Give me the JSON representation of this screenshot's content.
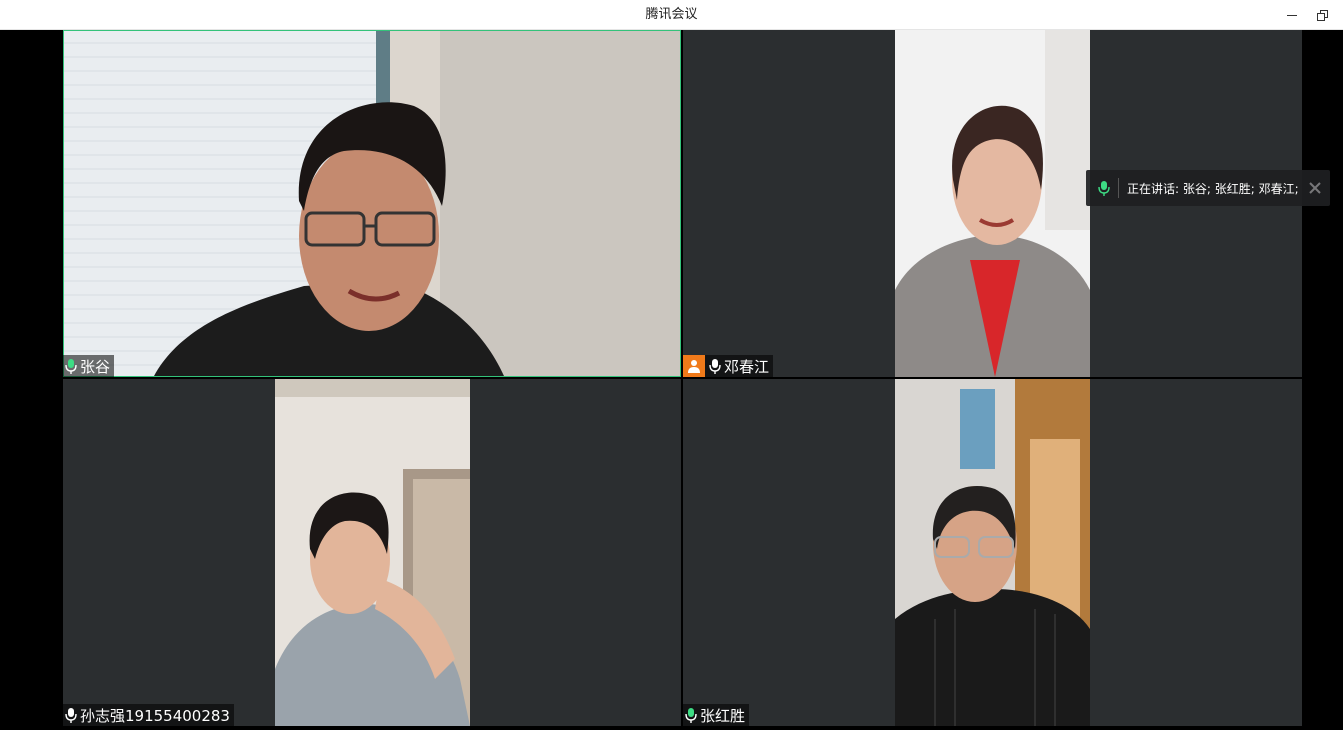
{
  "window": {
    "title": "腾讯会议"
  },
  "speaking_bar": {
    "text": "正在讲话: 张谷; 张红胜; 邓春江;"
  },
  "participants": [
    {
      "name": "张谷",
      "mic": "mic-on-green",
      "active_speaker": true
    },
    {
      "name": "邓春江",
      "mic": "mic-on",
      "host": true
    },
    {
      "name": "孙志强19155400283",
      "mic": "mic-on"
    },
    {
      "name": "张红胜",
      "mic": "mic-on-green"
    }
  ],
  "colors": {
    "tile_bg": "#2b2e30",
    "active_border": "#33c27a",
    "host_badge": "#f07a1a",
    "mic_green": "#3ddc84"
  }
}
